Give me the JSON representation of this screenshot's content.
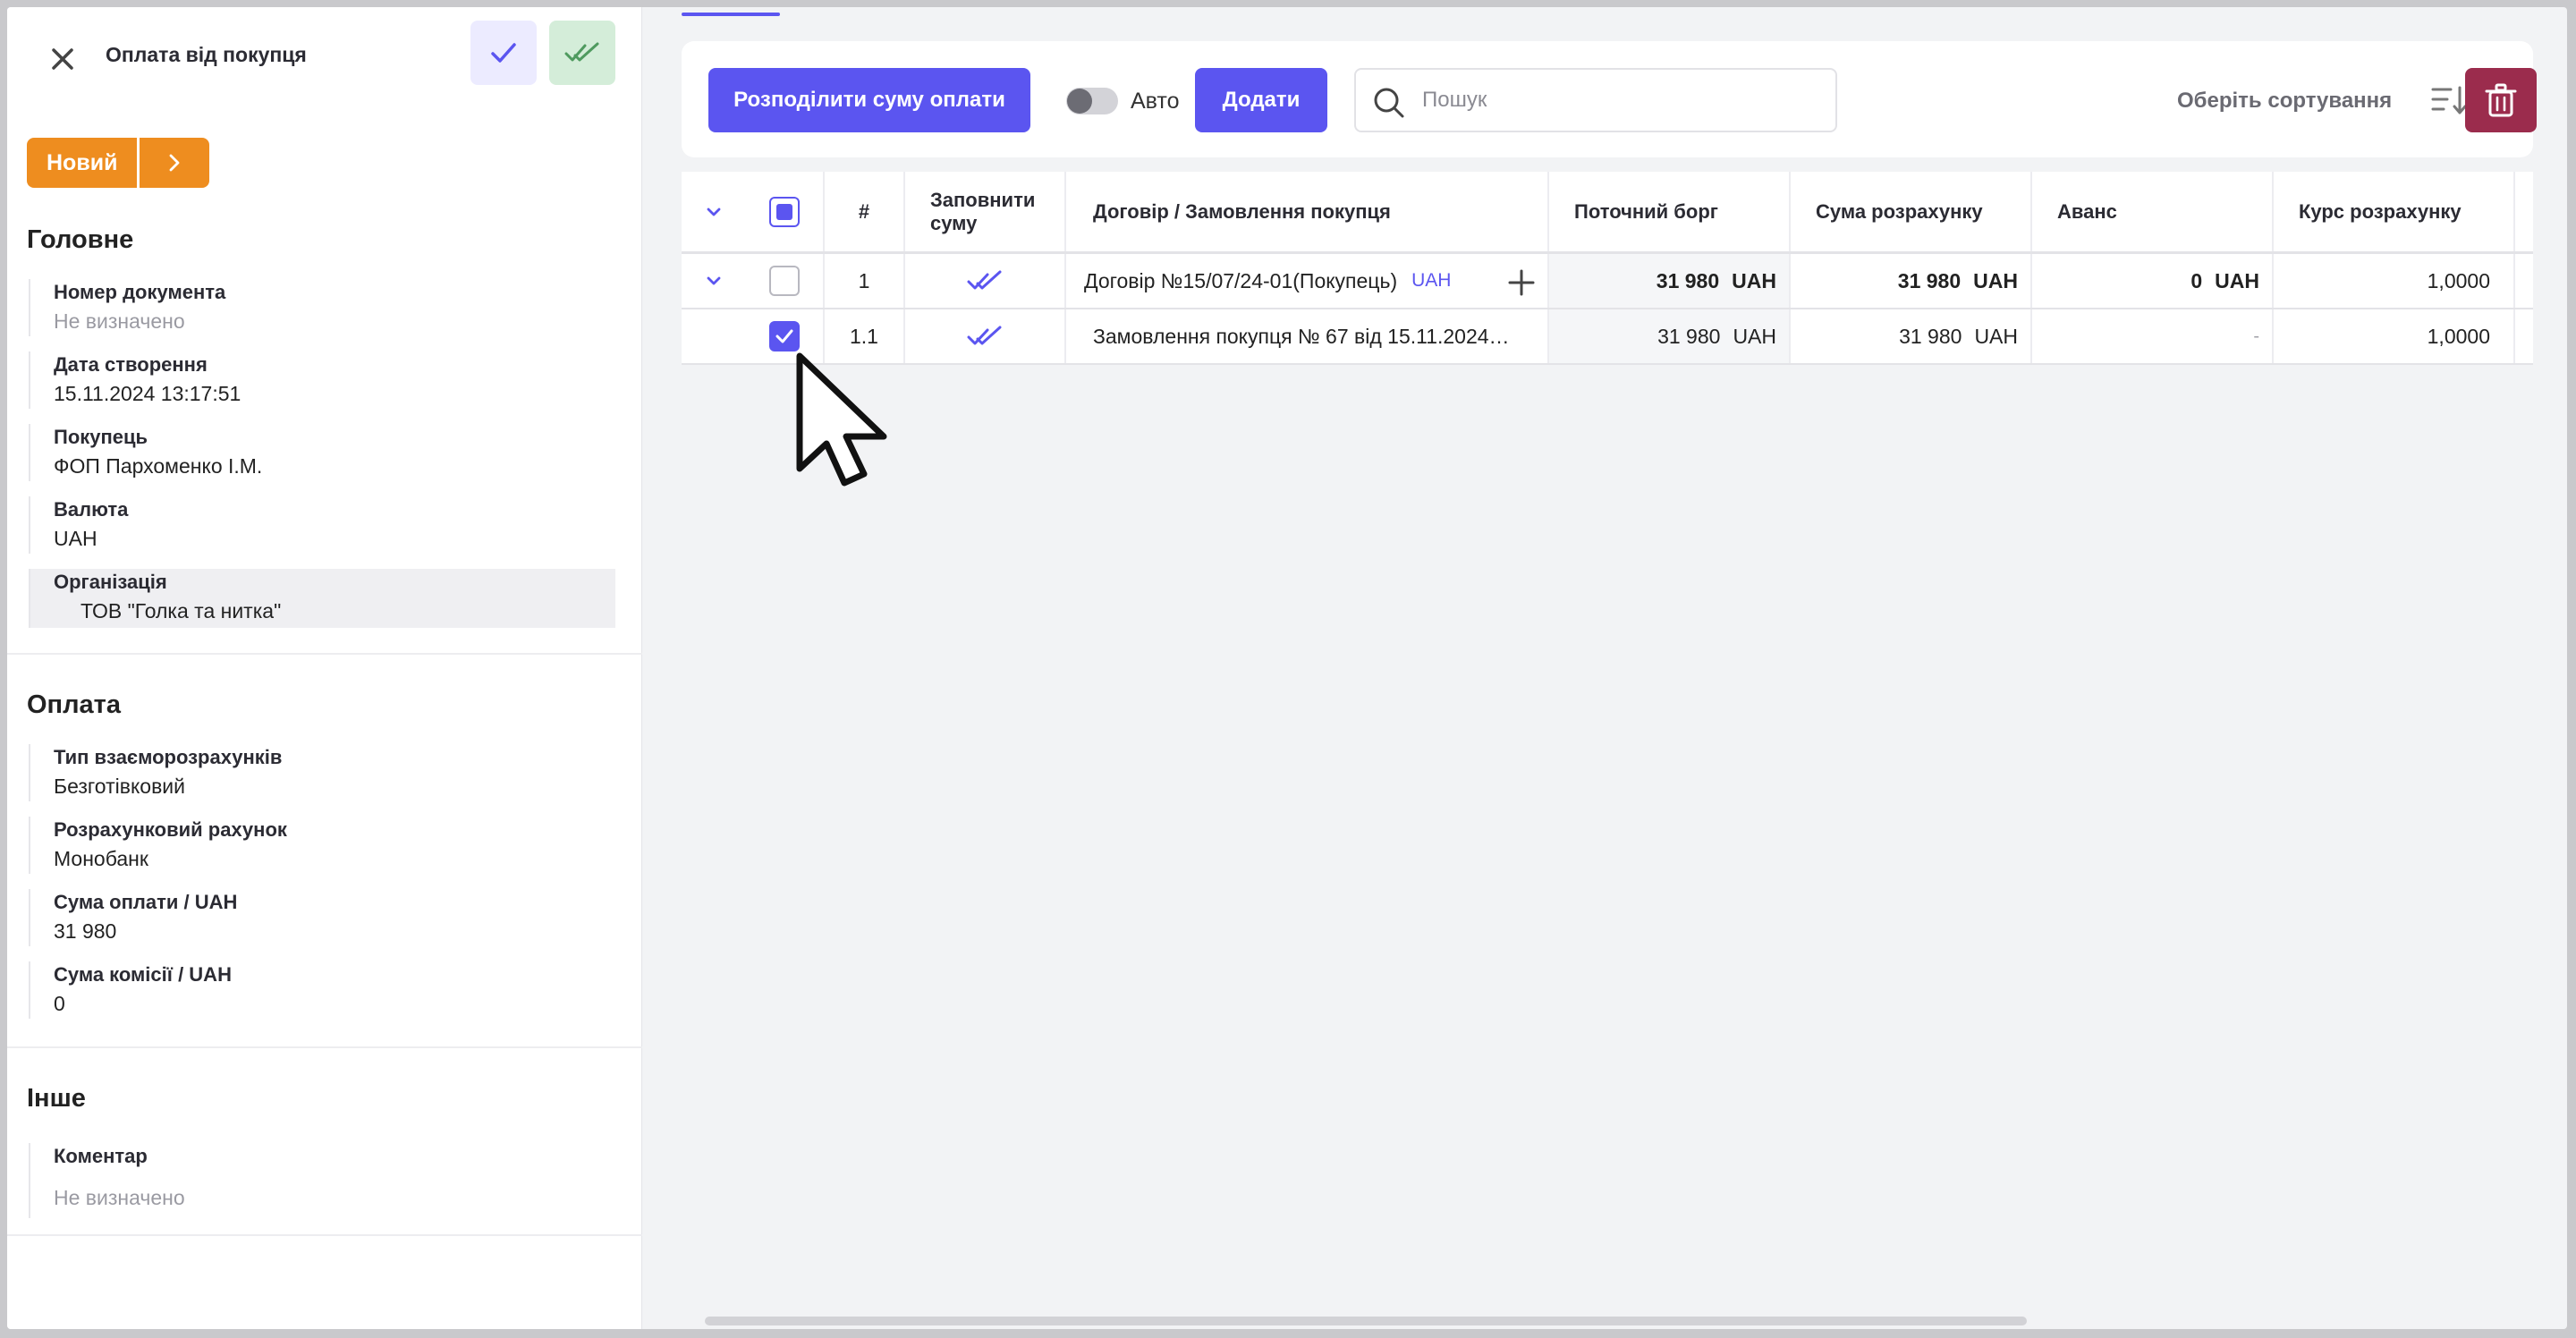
{
  "sidebar": {
    "title": "Оплата від покупця",
    "status": "Новий",
    "sections": {
      "main": "Головне",
      "payment": "Оплата",
      "other": "Інше"
    },
    "fields": {
      "doc_number": {
        "label": "Номер документа",
        "value": "Не визначено"
      },
      "created": {
        "label": "Дата створення",
        "value": "15.11.2024 13:17:51"
      },
      "buyer": {
        "label": "Покупець",
        "value": "ФОП Пархоменко І.М."
      },
      "currency": {
        "label": "Валюта",
        "value": "UAH"
      },
      "organization": {
        "label": "Організація",
        "value": "ТОВ \"Голка та нитка\""
      },
      "settlement_type": {
        "label": "Тип взаєморозрахунків",
        "value": "Безготівковий"
      },
      "account": {
        "label": "Розрахунковий рахунок",
        "value": "Монобанк"
      },
      "pay_sum": {
        "label": "Сума оплати / UAH",
        "value": "31 980"
      },
      "commission": {
        "label": "Сума комісії / UAH",
        "value": "0"
      },
      "comment": {
        "label": "Коментар",
        "value": "Не визначено"
      }
    }
  },
  "toolbar": {
    "distribute_label": "Розподілити суму оплати",
    "auto_label": "Авто",
    "auto_on": false,
    "add_label": "Додати",
    "search_placeholder": "Пошук",
    "sort_label": "Оберіть сортування"
  },
  "table": {
    "headers": {
      "num": "#",
      "fill": "Заповнити суму",
      "doc": "Договір / Замовлення покупця",
      "debt": "Поточний борг",
      "sum": "Сума розрахунку",
      "advance": "Аванс",
      "rate": "Курс розрахунку"
    },
    "rows": [
      {
        "num": "1",
        "doc": "Договір №15/07/24-01(Покупець)",
        "doc_currency": "UAH",
        "debt": "31 980",
        "debt_cur": "UAH",
        "sum": "31 980",
        "sum_cur": "UAH",
        "advance": "0",
        "advance_cur": "UAH",
        "rate": "1,0000",
        "checked": false
      },
      {
        "num": "1.1",
        "doc": "Замовлення покупця № 67 від 15.11.2024…",
        "debt": "31 980",
        "debt_cur": "UAH",
        "sum": "31 980",
        "sum_cur": "UAH",
        "advance": "-",
        "rate": "1,0000",
        "checked": true
      }
    ]
  },
  "colors": {
    "accent": "#5b55f0",
    "status": "#ee8d1f",
    "danger": "#9b2c4d",
    "success_bg": "#d4edd9"
  }
}
